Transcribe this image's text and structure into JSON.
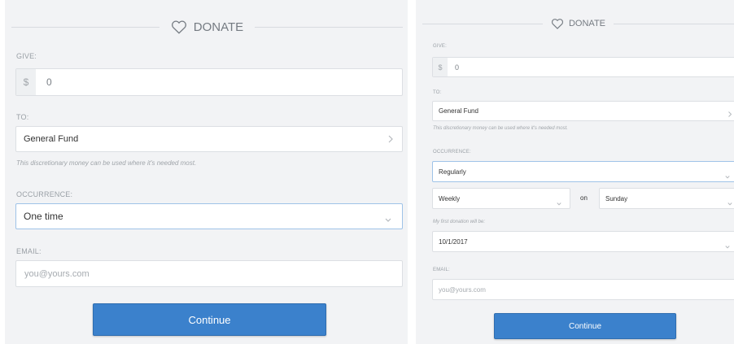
{
  "colors": {
    "accent": "#3b81cc",
    "background": "#f2f3f5",
    "label": "#9aa0a6"
  },
  "icons": {
    "donate": "heart-icon",
    "expand": "chevron-right-icon",
    "dropdown": "chevron-down-icon"
  },
  "left": {
    "header_title": "DONATE",
    "give_label": "GIVE:",
    "currency_symbol": "$",
    "amount_value": "0",
    "to_label": "TO:",
    "fund_value": "General Fund",
    "fund_note": "This discretionary money can be used where it's needed most.",
    "occurrence_label": "OCCURRENCE:",
    "occurrence_value": "One time",
    "email_label": "EMAIL:",
    "email_placeholder": "you@yours.com",
    "continue_label": "Continue"
  },
  "right": {
    "header_title": "DONATE",
    "give_label": "GIVE:",
    "currency_symbol": "$",
    "amount_value": "0",
    "to_label": "TO:",
    "fund_value": "General Fund",
    "fund_note": "This discretionary money can be used where it's needed most.",
    "occurrence_label": "OCCURRENCE:",
    "occurrence_value": "Regularly",
    "frequency_value": "Weekly",
    "on_label": "on",
    "day_value": "Sunday",
    "first_donation_label": "My first donation will be:",
    "first_date_value": "10/1/2017",
    "email_label": "EMAIL:",
    "email_placeholder": "you@yours.com",
    "continue_label": "Continue"
  }
}
